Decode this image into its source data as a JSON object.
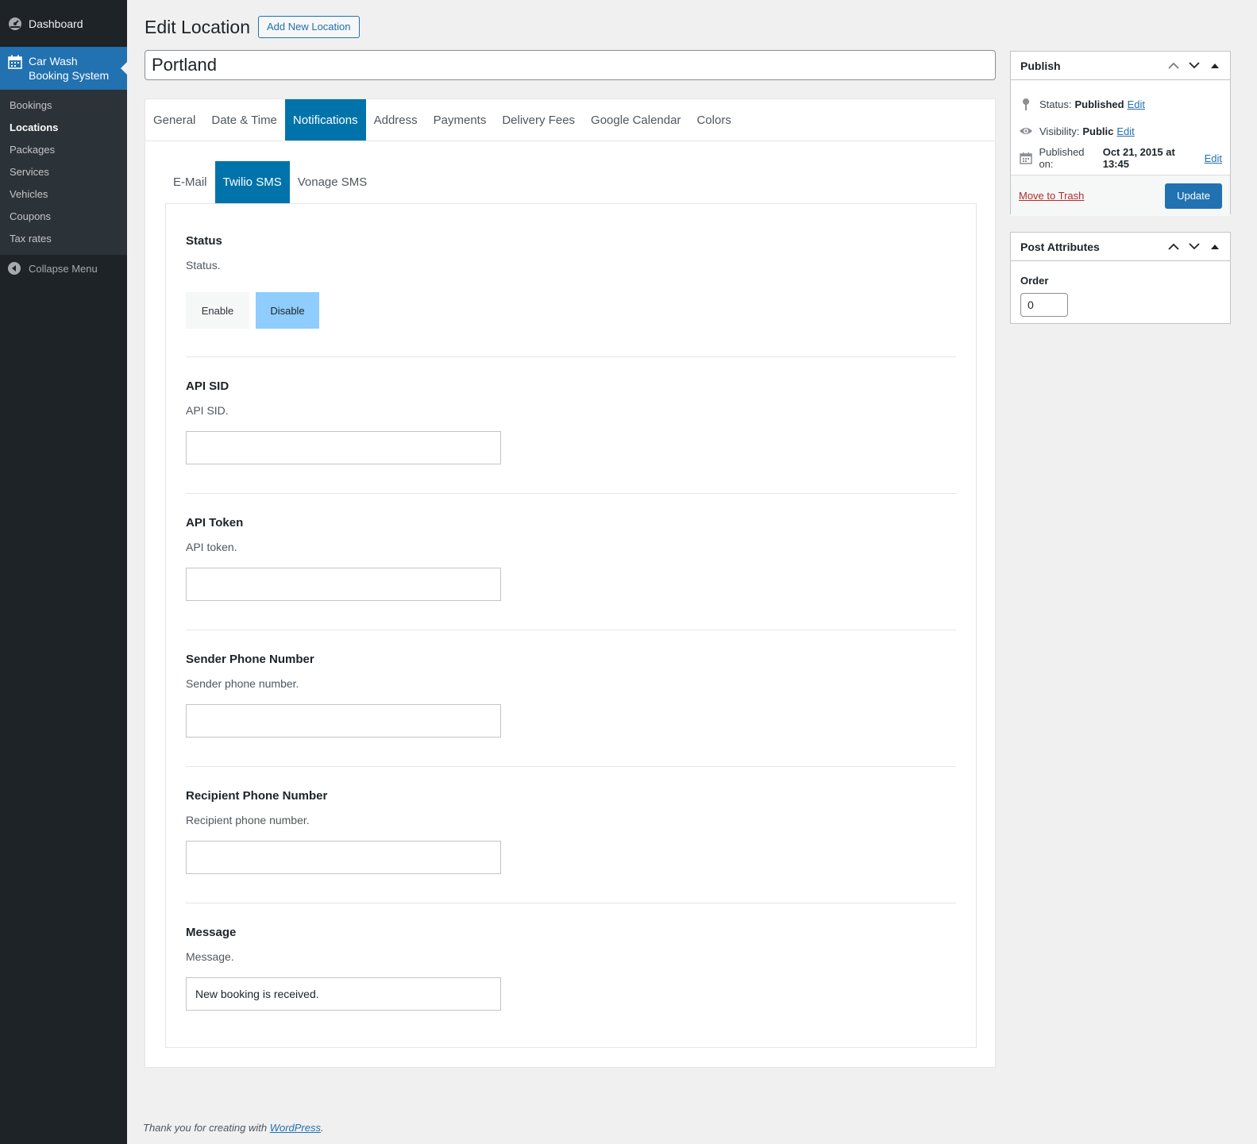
{
  "sidebar": {
    "dashboard_label": "Dashboard",
    "current_line1": "Car Wash",
    "current_line2": "Booking System",
    "submenu": [
      "Bookings",
      "Locations",
      "Packages",
      "Services",
      "Vehicles",
      "Coupons",
      "Tax rates"
    ],
    "submenu_current": "Locations",
    "collapse_label": "Collapse Menu"
  },
  "header": {
    "title": "Edit Location",
    "add_new_label": "Add New Location"
  },
  "post_title": "Portland",
  "tabs": [
    "General",
    "Date & Time",
    "Notifications",
    "Address",
    "Payments",
    "Delivery Fees",
    "Google Calendar",
    "Colors"
  ],
  "active_tab": "Notifications",
  "subtabs": [
    "E-Mail",
    "Twilio SMS",
    "Vonage SMS"
  ],
  "active_subtab": "Twilio SMS",
  "fields": {
    "status": {
      "title": "Status",
      "desc": "Status.",
      "enable": "Enable",
      "disable": "Disable",
      "selected": "Disable"
    },
    "api_sid": {
      "title": "API SID",
      "desc": "API SID.",
      "value": ""
    },
    "api_token": {
      "title": "API Token",
      "desc": "API token.",
      "value": ""
    },
    "sender": {
      "title": "Sender Phone Number",
      "desc": "Sender phone number.",
      "value": ""
    },
    "recipient": {
      "title": "Recipient Phone Number",
      "desc": "Recipient phone number.",
      "value": ""
    },
    "message": {
      "title": "Message",
      "desc": "Message.",
      "value": "New booking is received."
    }
  },
  "publish": {
    "title": "Publish",
    "status_label": "Status:",
    "status_value": "Published",
    "visibility_label": "Visibility:",
    "visibility_value": "Public",
    "published_label": "Published on:",
    "published_value": "Oct 21, 2015 at 13:45",
    "edit_label": "Edit",
    "trash_label": "Move to Trash",
    "update_label": "Update"
  },
  "attributes": {
    "title": "Post Attributes",
    "order_label": "Order",
    "order_value": "0"
  },
  "footer": {
    "text": "Thank you for creating with",
    "link": "WordPress",
    "end": "."
  },
  "colors": {
    "sidebar_bg": "#1d2327",
    "accent": "#2271b1",
    "tab_active": "#0073aa",
    "toggle_on": "#8ecdfd"
  }
}
